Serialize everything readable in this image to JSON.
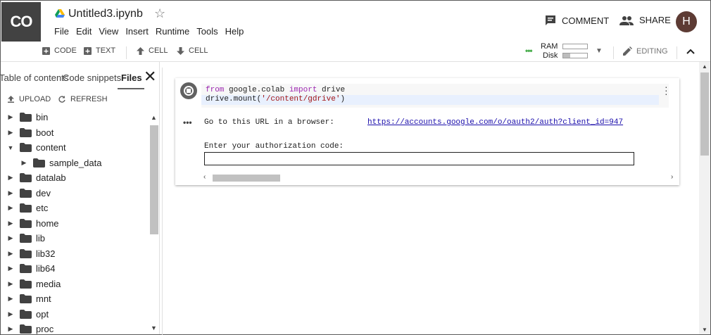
{
  "header": {
    "logo": "CO",
    "notebook_title": "Untitled3.ipynb",
    "menu": [
      "File",
      "Edit",
      "View",
      "Insert",
      "Runtime",
      "Tools",
      "Help"
    ],
    "comment_label": "COMMENT",
    "share_label": "SHARE",
    "avatar_letter": "H"
  },
  "toolbar": {
    "add_code": "CODE",
    "add_text": "TEXT",
    "cell_up": "CELL",
    "cell_down": "CELL",
    "ram_label": "RAM",
    "disk_label": "Disk",
    "ram_fraction": 0.0,
    "disk_fraction": 0.3,
    "editing_label": "EDITING"
  },
  "sidebar": {
    "tabs": [
      "Table of contents",
      "Code snippets",
      "Files"
    ],
    "active_tab": "Files",
    "upload_label": "UPLOAD",
    "refresh_label": "REFRESH",
    "tree": [
      {
        "name": "bin",
        "expanded": false,
        "depth": 0
      },
      {
        "name": "boot",
        "expanded": false,
        "depth": 0
      },
      {
        "name": "content",
        "expanded": true,
        "depth": 0
      },
      {
        "name": "sample_data",
        "expanded": false,
        "depth": 1
      },
      {
        "name": "datalab",
        "expanded": false,
        "depth": 0
      },
      {
        "name": "dev",
        "expanded": false,
        "depth": 0
      },
      {
        "name": "etc",
        "expanded": false,
        "depth": 0
      },
      {
        "name": "home",
        "expanded": false,
        "depth": 0
      },
      {
        "name": "lib",
        "expanded": false,
        "depth": 0
      },
      {
        "name": "lib32",
        "expanded": false,
        "depth": 0
      },
      {
        "name": "lib64",
        "expanded": false,
        "depth": 0
      },
      {
        "name": "media",
        "expanded": false,
        "depth": 0
      },
      {
        "name": "mnt",
        "expanded": false,
        "depth": 0
      },
      {
        "name": "opt",
        "expanded": false,
        "depth": 0
      },
      {
        "name": "proc",
        "expanded": false,
        "depth": 0
      }
    ]
  },
  "cell": {
    "code": {
      "l1_kw1": "from",
      "l1_mod": " google.colab ",
      "l1_kw2": "import",
      "l1_name": " drive",
      "l2_call": "drive.mount(",
      "l2_str": "'/content/gdrive'",
      "l2_end": ")"
    },
    "output": {
      "line1": "Go to this URL in a browser: ",
      "url": "https://accounts.google.com/o/oauth2/auth?client_id=947",
      "line2": "Enter your authorization code:",
      "input_value": ""
    }
  },
  "colors": {
    "logo_bg": "#424242",
    "avatar_bg": "#5d3b34",
    "resources_ok": "#4caf50",
    "link": "#1a0dab"
  }
}
